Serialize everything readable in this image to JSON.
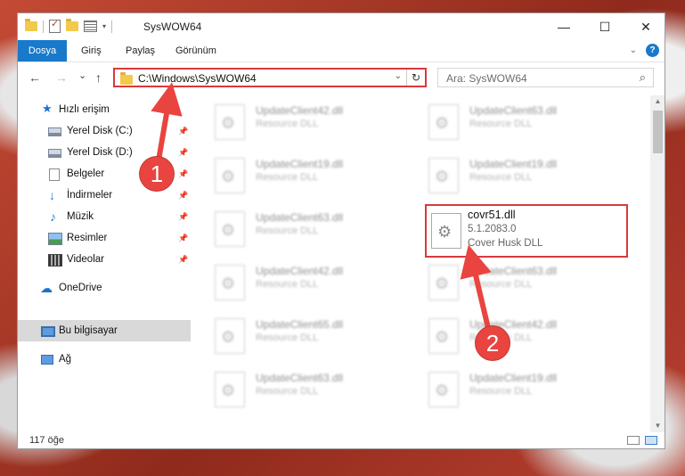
{
  "titlebar": {
    "title": "SysWOW64",
    "minimize": "—",
    "maximize": "☐",
    "close": "✕"
  },
  "ribbon": {
    "tabs": [
      "Dosya",
      "Giriş",
      "Paylaş",
      "Görünüm"
    ],
    "help": "?"
  },
  "nav": {
    "back": "←",
    "forward": "→",
    "recent": "⌄",
    "up": "↑"
  },
  "address": {
    "path": "C:\\Windows\\SysWOW64",
    "dropdown": "⌄",
    "refresh": "↻"
  },
  "search": {
    "placeholder": "Ara: SysWOW64"
  },
  "sidebar": {
    "items": [
      {
        "label": "Hızlı erişim"
      },
      {
        "label": "Yerel Disk (C:)"
      },
      {
        "label": "Yerel Disk (D:)"
      },
      {
        "label": "Belgeler"
      },
      {
        "label": "İndirmeler"
      },
      {
        "label": "Müzik"
      },
      {
        "label": "Resimler"
      },
      {
        "label": "Videolar"
      },
      {
        "label": "OneDrive"
      },
      {
        "label": "Bu bilgisayar"
      },
      {
        "label": "Ağ"
      }
    ]
  },
  "files": [
    {
      "name": "UpdateClient42.dll",
      "desc": "Resource DLL"
    },
    {
      "name": "UpdateClient63.dll",
      "desc": "Resource DLL"
    },
    {
      "name": "UpdateClient19.dll",
      "desc": "Resource DLL"
    },
    {
      "name": "UpdateClient19.dll",
      "desc": "Resource DLL"
    },
    {
      "name": "UpdateClient63.dll",
      "desc": "Resource DLL"
    },
    {
      "name": "UpdateClient42.dll",
      "desc": "Resource DLL"
    },
    {
      "name": "UpdateClient63.dll",
      "desc": "Resource DLL"
    },
    {
      "name": "UpdateClient65.dll",
      "desc": "Resource DLL"
    },
    {
      "name": "UpdateClient42.dll",
      "desc": "Resource DLL"
    },
    {
      "name": "UpdateClient63.dll",
      "desc": "Resource DLL"
    },
    {
      "name": "UpdateClient19.dll",
      "desc": "Resource DLL"
    }
  ],
  "highlighted_file": {
    "name": "covr51.dll",
    "version": "5.1.2083.0",
    "desc": "Cover Husk DLL"
  },
  "annotations": {
    "step1": "1",
    "step2": "2"
  },
  "status": {
    "count": "117 öğe"
  },
  "colors": {
    "accent": "#1979ca",
    "highlight": "#d9393c"
  }
}
